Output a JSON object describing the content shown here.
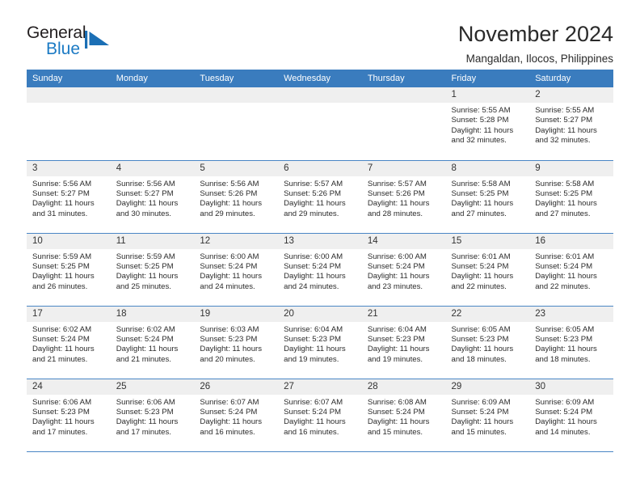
{
  "brand": {
    "name_line1": "General",
    "name_line2": "Blue",
    "logo_icon": "triangle-flag-icon",
    "color_primary": "#1b7ac4",
    "color_dark": "#231f20"
  },
  "header": {
    "title": "November 2024",
    "subtitle": "Mangaldan, Ilocos, Philippines"
  },
  "theme": {
    "header_row_bg": "#3a7cbe",
    "daynum_bg": "#efefef",
    "row_border": "#4a86c5"
  },
  "weekdays": [
    "Sunday",
    "Monday",
    "Tuesday",
    "Wednesday",
    "Thursday",
    "Friday",
    "Saturday"
  ],
  "weeks": [
    [
      {
        "day": "",
        "empty": true
      },
      {
        "day": "",
        "empty": true
      },
      {
        "day": "",
        "empty": true
      },
      {
        "day": "",
        "empty": true
      },
      {
        "day": "",
        "empty": true
      },
      {
        "day": "1",
        "sunrise": "Sunrise: 5:55 AM",
        "sunset": "Sunset: 5:28 PM",
        "daylight": "Daylight: 11 hours and 32 minutes."
      },
      {
        "day": "2",
        "sunrise": "Sunrise: 5:55 AM",
        "sunset": "Sunset: 5:27 PM",
        "daylight": "Daylight: 11 hours and 32 minutes."
      }
    ],
    [
      {
        "day": "3",
        "sunrise": "Sunrise: 5:56 AM",
        "sunset": "Sunset: 5:27 PM",
        "daylight": "Daylight: 11 hours and 31 minutes."
      },
      {
        "day": "4",
        "sunrise": "Sunrise: 5:56 AM",
        "sunset": "Sunset: 5:27 PM",
        "daylight": "Daylight: 11 hours and 30 minutes."
      },
      {
        "day": "5",
        "sunrise": "Sunrise: 5:56 AM",
        "sunset": "Sunset: 5:26 PM",
        "daylight": "Daylight: 11 hours and 29 minutes."
      },
      {
        "day": "6",
        "sunrise": "Sunrise: 5:57 AM",
        "sunset": "Sunset: 5:26 PM",
        "daylight": "Daylight: 11 hours and 29 minutes."
      },
      {
        "day": "7",
        "sunrise": "Sunrise: 5:57 AM",
        "sunset": "Sunset: 5:26 PM",
        "daylight": "Daylight: 11 hours and 28 minutes."
      },
      {
        "day": "8",
        "sunrise": "Sunrise: 5:58 AM",
        "sunset": "Sunset: 5:25 PM",
        "daylight": "Daylight: 11 hours and 27 minutes."
      },
      {
        "day": "9",
        "sunrise": "Sunrise: 5:58 AM",
        "sunset": "Sunset: 5:25 PM",
        "daylight": "Daylight: 11 hours and 27 minutes."
      }
    ],
    [
      {
        "day": "10",
        "sunrise": "Sunrise: 5:59 AM",
        "sunset": "Sunset: 5:25 PM",
        "daylight": "Daylight: 11 hours and 26 minutes."
      },
      {
        "day": "11",
        "sunrise": "Sunrise: 5:59 AM",
        "sunset": "Sunset: 5:25 PM",
        "daylight": "Daylight: 11 hours and 25 minutes."
      },
      {
        "day": "12",
        "sunrise": "Sunrise: 6:00 AM",
        "sunset": "Sunset: 5:24 PM",
        "daylight": "Daylight: 11 hours and 24 minutes."
      },
      {
        "day": "13",
        "sunrise": "Sunrise: 6:00 AM",
        "sunset": "Sunset: 5:24 PM",
        "daylight": "Daylight: 11 hours and 24 minutes."
      },
      {
        "day": "14",
        "sunrise": "Sunrise: 6:00 AM",
        "sunset": "Sunset: 5:24 PM",
        "daylight": "Daylight: 11 hours and 23 minutes."
      },
      {
        "day": "15",
        "sunrise": "Sunrise: 6:01 AM",
        "sunset": "Sunset: 5:24 PM",
        "daylight": "Daylight: 11 hours and 22 minutes."
      },
      {
        "day": "16",
        "sunrise": "Sunrise: 6:01 AM",
        "sunset": "Sunset: 5:24 PM",
        "daylight": "Daylight: 11 hours and 22 minutes."
      }
    ],
    [
      {
        "day": "17",
        "sunrise": "Sunrise: 6:02 AM",
        "sunset": "Sunset: 5:24 PM",
        "daylight": "Daylight: 11 hours and 21 minutes."
      },
      {
        "day": "18",
        "sunrise": "Sunrise: 6:02 AM",
        "sunset": "Sunset: 5:24 PM",
        "daylight": "Daylight: 11 hours and 21 minutes."
      },
      {
        "day": "19",
        "sunrise": "Sunrise: 6:03 AM",
        "sunset": "Sunset: 5:23 PM",
        "daylight": "Daylight: 11 hours and 20 minutes."
      },
      {
        "day": "20",
        "sunrise": "Sunrise: 6:04 AM",
        "sunset": "Sunset: 5:23 PM",
        "daylight": "Daylight: 11 hours and 19 minutes."
      },
      {
        "day": "21",
        "sunrise": "Sunrise: 6:04 AM",
        "sunset": "Sunset: 5:23 PM",
        "daylight": "Daylight: 11 hours and 19 minutes."
      },
      {
        "day": "22",
        "sunrise": "Sunrise: 6:05 AM",
        "sunset": "Sunset: 5:23 PM",
        "daylight": "Daylight: 11 hours and 18 minutes."
      },
      {
        "day": "23",
        "sunrise": "Sunrise: 6:05 AM",
        "sunset": "Sunset: 5:23 PM",
        "daylight": "Daylight: 11 hours and 18 minutes."
      }
    ],
    [
      {
        "day": "24",
        "sunrise": "Sunrise: 6:06 AM",
        "sunset": "Sunset: 5:23 PM",
        "daylight": "Daylight: 11 hours and 17 minutes."
      },
      {
        "day": "25",
        "sunrise": "Sunrise: 6:06 AM",
        "sunset": "Sunset: 5:23 PM",
        "daylight": "Daylight: 11 hours and 17 minutes."
      },
      {
        "day": "26",
        "sunrise": "Sunrise: 6:07 AM",
        "sunset": "Sunset: 5:24 PM",
        "daylight": "Daylight: 11 hours and 16 minutes."
      },
      {
        "day": "27",
        "sunrise": "Sunrise: 6:07 AM",
        "sunset": "Sunset: 5:24 PM",
        "daylight": "Daylight: 11 hours and 16 minutes."
      },
      {
        "day": "28",
        "sunrise": "Sunrise: 6:08 AM",
        "sunset": "Sunset: 5:24 PM",
        "daylight": "Daylight: 11 hours and 15 minutes."
      },
      {
        "day": "29",
        "sunrise": "Sunrise: 6:09 AM",
        "sunset": "Sunset: 5:24 PM",
        "daylight": "Daylight: 11 hours and 15 minutes."
      },
      {
        "day": "30",
        "sunrise": "Sunrise: 6:09 AM",
        "sunset": "Sunset: 5:24 PM",
        "daylight": "Daylight: 11 hours and 14 minutes."
      }
    ]
  ]
}
